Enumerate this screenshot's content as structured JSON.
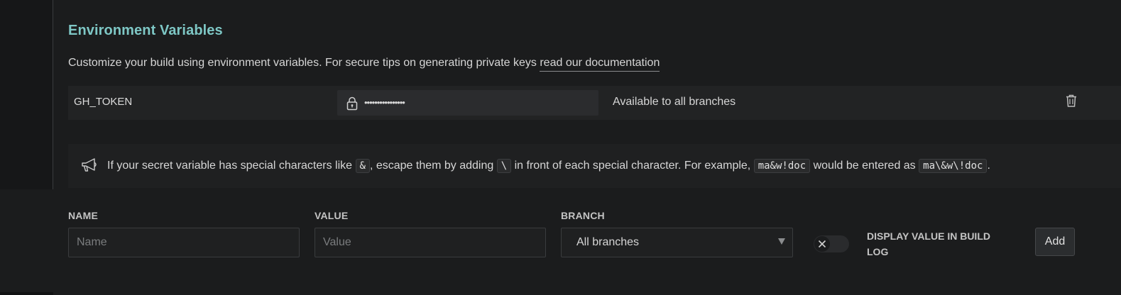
{
  "section": {
    "title": "Environment Variables",
    "description_prefix": "Customize your build using environment variables. For secure tips on generating private keys",
    "doc_link": "read our documentation"
  },
  "variable": {
    "key": "GH_TOKEN",
    "masked_value": "••••••••••••••••",
    "branch_scope": "Available to all branches",
    "lock_icon": "lock-icon",
    "delete_icon": "trash-icon"
  },
  "notice": {
    "icon": "megaphone-icon",
    "t1": "If your secret variable has special characters like",
    "c1": "&",
    "t2": ", escape them by adding",
    "c2": "\\",
    "t3": "in front of each special character. For example,",
    "c3": "ma&w!doc",
    "t4": "would be entered as",
    "c4": "ma\\&w\\!doc",
    "t5": "."
  },
  "form": {
    "name_label": "NAME",
    "name_placeholder": "Name",
    "value_label": "VALUE",
    "value_placeholder": "Value",
    "branch_label": "BRANCH",
    "branch_selected": "All branches",
    "toggle_label": "DISPLAY VALUE IN BUILD LOG",
    "toggle_on": false,
    "add_label": "Add"
  },
  "colors": {
    "background": "#1b1c1d",
    "accent_title": "#7ec7c5",
    "row_background": "#222324"
  }
}
